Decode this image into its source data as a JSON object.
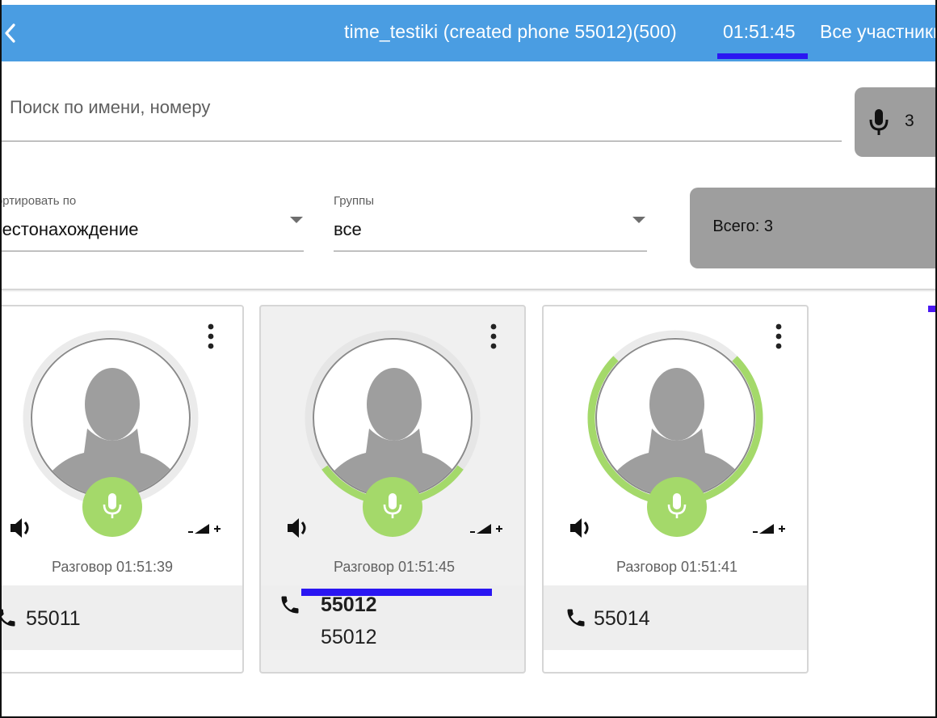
{
  "header": {
    "title": "time_testiki (created phone 55012)(500)",
    "timer": "01:51:45",
    "tab_all": "Все участники"
  },
  "search": {
    "placeholder": "Поиск по имени, номеру",
    "mic_count": "3"
  },
  "sort": {
    "label": "Сортировать по",
    "value": "Местонахождение"
  },
  "groups": {
    "label": "Группы",
    "value": "все"
  },
  "total": "Всего: 3",
  "colors": {
    "header": "#4a9de2",
    "accent": "#2a16f2",
    "mic_green": "#a4d96a",
    "ring_green": "#a4d96a"
  },
  "participants": [
    {
      "status": "Разговор 01:51:39",
      "number": "55011",
      "name": "",
      "speaking_level": 0.1
    },
    {
      "status": "Разговор 01:51:45",
      "number": "55012",
      "name": "55012",
      "speaking_level": 0.3
    },
    {
      "status": "Разговор 01:51:41",
      "number": "55014",
      "name": "",
      "speaking_level": 0.75
    }
  ]
}
